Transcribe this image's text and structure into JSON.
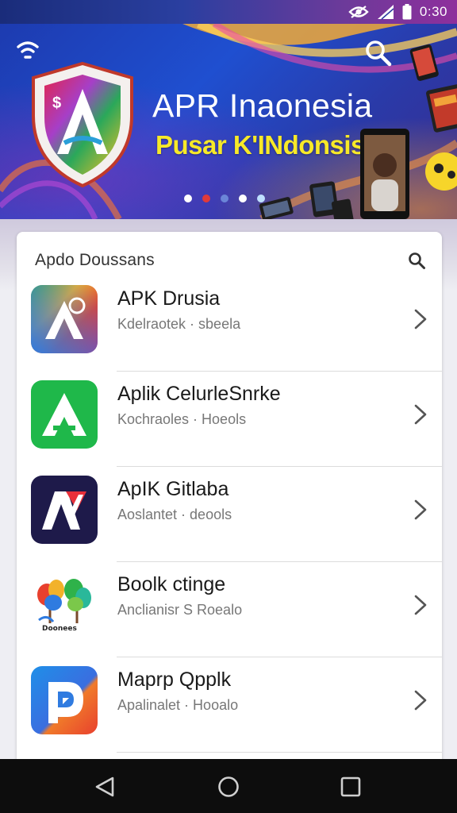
{
  "status_bar": {
    "time": "0:30",
    "icons": [
      "eye-icon",
      "signal-icon",
      "battery-icon"
    ]
  },
  "hero": {
    "title": "APR Inaonesia",
    "subtitle": "Pusar K'INdonsis",
    "icons": [
      "wifi-icon",
      "search-icon",
      "shield-logo"
    ],
    "page_indicator": {
      "count": 5,
      "active": 1
    },
    "colors": {
      "title": "#ffffff",
      "subtitle": "#f7e928",
      "background": "#1f4fd0"
    }
  },
  "card": {
    "title": "Apdo Doussans",
    "search_icon": "search-icon",
    "apps": [
      {
        "name": "APK Drusia",
        "subtitle": "Kdelraotek · sbeela",
        "icon": "app-icon-drusia"
      },
      {
        "name": "Aplik CelurleSnrke",
        "subtitle": "Kochraoles · Hoeols",
        "icon": "app-icon-celurle"
      },
      {
        "name": "ApIK Gitlaba",
        "subtitle": "Aoslantet · deools",
        "icon": "app-icon-gitlaba"
      },
      {
        "name": "Boolk ctinge",
        "subtitle": "Anclianisr S Roealo",
        "icon": "app-icon-boolk",
        "icon_text": "Doonees"
      },
      {
        "name": "Maprp Qpplk",
        "subtitle": "Apalinalet · Hooalo",
        "icon": "app-icon-maprp"
      }
    ]
  },
  "nav_bar": {
    "buttons": [
      "back-icon",
      "home-icon",
      "recents-icon"
    ]
  }
}
